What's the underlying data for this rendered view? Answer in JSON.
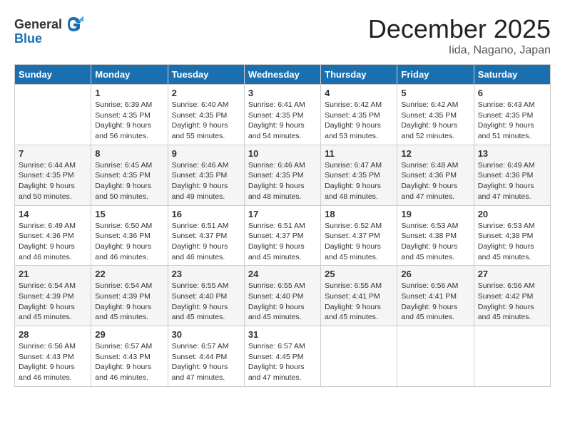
{
  "header": {
    "logo_general": "General",
    "logo_blue": "Blue",
    "month": "December 2025",
    "location": "Iida, Nagano, Japan"
  },
  "weekdays": [
    "Sunday",
    "Monday",
    "Tuesday",
    "Wednesday",
    "Thursday",
    "Friday",
    "Saturday"
  ],
  "weeks": [
    [
      {
        "day": "",
        "info": ""
      },
      {
        "day": "1",
        "info": "Sunrise: 6:39 AM\nSunset: 4:35 PM\nDaylight: 9 hours\nand 56 minutes."
      },
      {
        "day": "2",
        "info": "Sunrise: 6:40 AM\nSunset: 4:35 PM\nDaylight: 9 hours\nand 55 minutes."
      },
      {
        "day": "3",
        "info": "Sunrise: 6:41 AM\nSunset: 4:35 PM\nDaylight: 9 hours\nand 54 minutes."
      },
      {
        "day": "4",
        "info": "Sunrise: 6:42 AM\nSunset: 4:35 PM\nDaylight: 9 hours\nand 53 minutes."
      },
      {
        "day": "5",
        "info": "Sunrise: 6:42 AM\nSunset: 4:35 PM\nDaylight: 9 hours\nand 52 minutes."
      },
      {
        "day": "6",
        "info": "Sunrise: 6:43 AM\nSunset: 4:35 PM\nDaylight: 9 hours\nand 51 minutes."
      }
    ],
    [
      {
        "day": "7",
        "info": "Sunrise: 6:44 AM\nSunset: 4:35 PM\nDaylight: 9 hours\nand 50 minutes."
      },
      {
        "day": "8",
        "info": "Sunrise: 6:45 AM\nSunset: 4:35 PM\nDaylight: 9 hours\nand 50 minutes."
      },
      {
        "day": "9",
        "info": "Sunrise: 6:46 AM\nSunset: 4:35 PM\nDaylight: 9 hours\nand 49 minutes."
      },
      {
        "day": "10",
        "info": "Sunrise: 6:46 AM\nSunset: 4:35 PM\nDaylight: 9 hours\nand 48 minutes."
      },
      {
        "day": "11",
        "info": "Sunrise: 6:47 AM\nSunset: 4:35 PM\nDaylight: 9 hours\nand 48 minutes."
      },
      {
        "day": "12",
        "info": "Sunrise: 6:48 AM\nSunset: 4:36 PM\nDaylight: 9 hours\nand 47 minutes."
      },
      {
        "day": "13",
        "info": "Sunrise: 6:49 AM\nSunset: 4:36 PM\nDaylight: 9 hours\nand 47 minutes."
      }
    ],
    [
      {
        "day": "14",
        "info": "Sunrise: 6:49 AM\nSunset: 4:36 PM\nDaylight: 9 hours\nand 46 minutes."
      },
      {
        "day": "15",
        "info": "Sunrise: 6:50 AM\nSunset: 4:36 PM\nDaylight: 9 hours\nand 46 minutes."
      },
      {
        "day": "16",
        "info": "Sunrise: 6:51 AM\nSunset: 4:37 PM\nDaylight: 9 hours\nand 46 minutes."
      },
      {
        "day": "17",
        "info": "Sunrise: 6:51 AM\nSunset: 4:37 PM\nDaylight: 9 hours\nand 45 minutes."
      },
      {
        "day": "18",
        "info": "Sunrise: 6:52 AM\nSunset: 4:37 PM\nDaylight: 9 hours\nand 45 minutes."
      },
      {
        "day": "19",
        "info": "Sunrise: 6:53 AM\nSunset: 4:38 PM\nDaylight: 9 hours\nand 45 minutes."
      },
      {
        "day": "20",
        "info": "Sunrise: 6:53 AM\nSunset: 4:38 PM\nDaylight: 9 hours\nand 45 minutes."
      }
    ],
    [
      {
        "day": "21",
        "info": "Sunrise: 6:54 AM\nSunset: 4:39 PM\nDaylight: 9 hours\nand 45 minutes."
      },
      {
        "day": "22",
        "info": "Sunrise: 6:54 AM\nSunset: 4:39 PM\nDaylight: 9 hours\nand 45 minutes."
      },
      {
        "day": "23",
        "info": "Sunrise: 6:55 AM\nSunset: 4:40 PM\nDaylight: 9 hours\nand 45 minutes."
      },
      {
        "day": "24",
        "info": "Sunrise: 6:55 AM\nSunset: 4:40 PM\nDaylight: 9 hours\nand 45 minutes."
      },
      {
        "day": "25",
        "info": "Sunrise: 6:55 AM\nSunset: 4:41 PM\nDaylight: 9 hours\nand 45 minutes."
      },
      {
        "day": "26",
        "info": "Sunrise: 6:56 AM\nSunset: 4:41 PM\nDaylight: 9 hours\nand 45 minutes."
      },
      {
        "day": "27",
        "info": "Sunrise: 6:56 AM\nSunset: 4:42 PM\nDaylight: 9 hours\nand 45 minutes."
      }
    ],
    [
      {
        "day": "28",
        "info": "Sunrise: 6:56 AM\nSunset: 4:43 PM\nDaylight: 9 hours\nand 46 minutes."
      },
      {
        "day": "29",
        "info": "Sunrise: 6:57 AM\nSunset: 4:43 PM\nDaylight: 9 hours\nand 46 minutes."
      },
      {
        "day": "30",
        "info": "Sunrise: 6:57 AM\nSunset: 4:44 PM\nDaylight: 9 hours\nand 47 minutes."
      },
      {
        "day": "31",
        "info": "Sunrise: 6:57 AM\nSunset: 4:45 PM\nDaylight: 9 hours\nand 47 minutes."
      },
      {
        "day": "",
        "info": ""
      },
      {
        "day": "",
        "info": ""
      },
      {
        "day": "",
        "info": ""
      }
    ]
  ]
}
